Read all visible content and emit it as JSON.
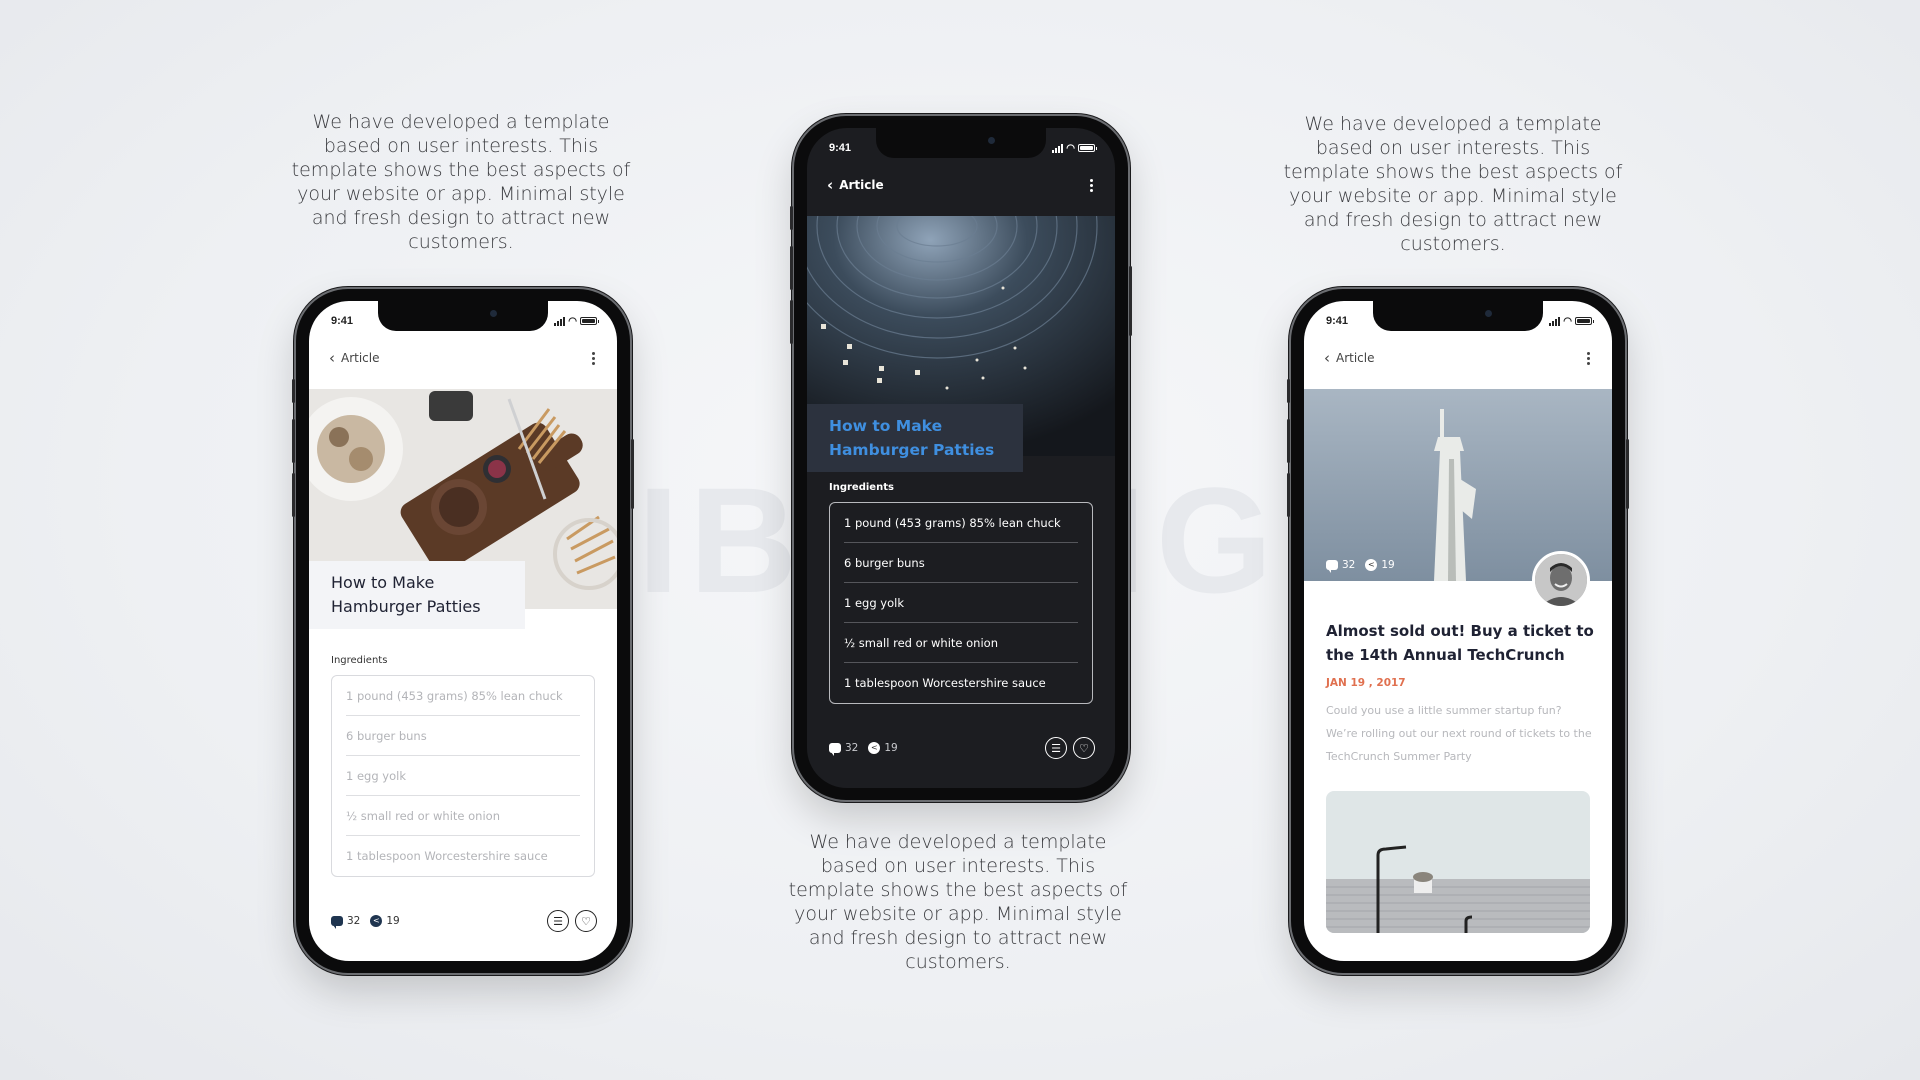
{
  "watermark": "IBO DIG",
  "blurbs": {
    "left": "We have developed a template based on user interests. This template shows the best aspects of your website or app. Minimal style and fresh design to attract new customers.",
    "center": "We have developed a template based on user interests. This template shows the best aspects of your website or app. Minimal style and fresh design to attract new customers.",
    "right": "We have developed a template based on user interests. This template shows the best aspects of your website or app. Minimal style and fresh design to attract new customers."
  },
  "phones": {
    "left": {
      "theme": "light",
      "status_time": "9:41",
      "nav_back_label": "Article",
      "hero_image": "hamburger-and-fries-photo",
      "title": "How to Make Hamburger Patties",
      "section_label": "Ingredients",
      "ingredients": [
        "1 pound (453 grams) 85% lean chuck",
        "6 burger buns",
        "1 egg yolk",
        "½ small red or white onion",
        "1 tablespoon Worcestershire sauce"
      ],
      "comments": "32",
      "shares": "19"
    },
    "center": {
      "theme": "dark",
      "status_time": "9:41",
      "nav_back_label": "Article",
      "hero_image": "spiral-building-photo",
      "title": "How to Make Hamburger Patties",
      "title_color": "#3f8fe0",
      "section_label": "Ingredients",
      "ingredients": [
        "1 pound (453 grams) 85% lean chuck",
        "6 burger buns",
        "1 egg yolk",
        "½ small red or white onion",
        "1 tablespoon Worcestershire sauce"
      ],
      "comments": "32",
      "shares": "19"
    },
    "right": {
      "theme": "light",
      "status_time": "9:41",
      "nav_back_label": "Article",
      "hero_image": "statue-of-liberty-photo",
      "comments": "32",
      "shares": "19",
      "title": "Almost sold out! Buy a ticket to the 14th Annual TechCrunch",
      "date": "JAN 19 , 2017",
      "date_color": "#e0704f",
      "excerpt": "Could you use a little summer startup fun? We’re rolling out our next round of tickets to the TechCrunch Summer Party",
      "secondary_image": "rooftop-lamppost-photo"
    }
  }
}
